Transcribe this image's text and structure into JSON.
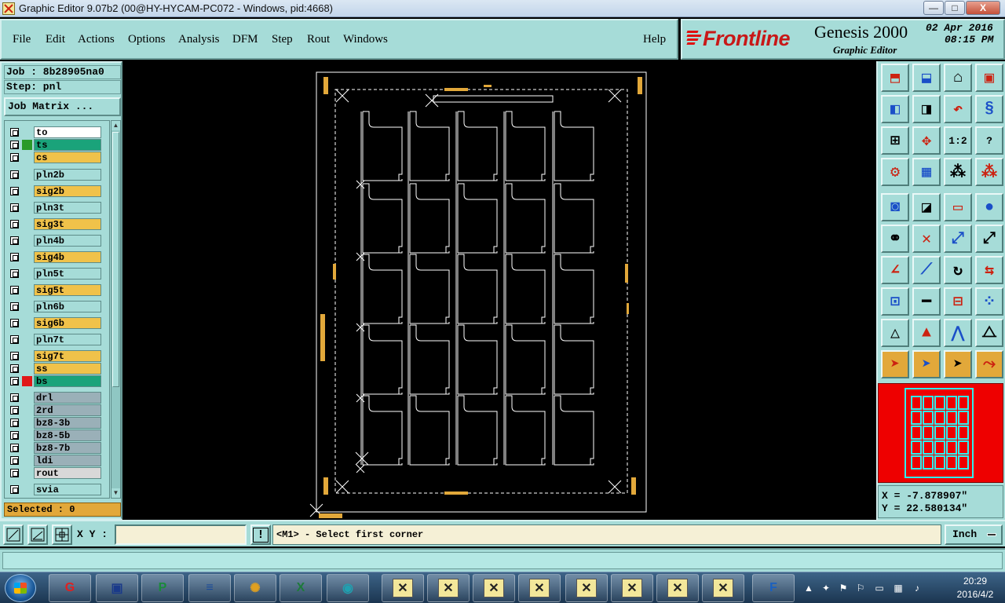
{
  "window": {
    "title": "Graphic Editor 9.07b2 (00@HY-HYCAM-PC072 - Windows, pid:4668)",
    "minimize_label": "—",
    "maximize_label": "□",
    "close_label": "X"
  },
  "menu": {
    "items": [
      {
        "id": "file",
        "label": "File"
      },
      {
        "id": "edit",
        "label": "Edit"
      },
      {
        "id": "actions",
        "label": "Actions"
      },
      {
        "id": "options",
        "label": "Options"
      },
      {
        "id": "analysis",
        "label": "Analysis"
      },
      {
        "id": "dfm",
        "label": "DFM"
      },
      {
        "id": "step",
        "label": "Step"
      },
      {
        "id": "rout",
        "label": "Rout"
      },
      {
        "id": "windows",
        "label": "Windows"
      },
      {
        "id": "help",
        "label": "Help"
      }
    ]
  },
  "brand": {
    "logo": "Frontline",
    "product": "Genesis 2000",
    "subtitle": "Graphic Editor",
    "date": "02 Apr 2016",
    "time": "08:15 PM"
  },
  "job": {
    "job_text": "Job : 8b28905na0",
    "step_text": "Step: pnl",
    "job_matrix_label": "Job Matrix ...",
    "selected_text": "Selected : 0"
  },
  "layers": [
    {
      "name": "to",
      "color": "#ffffff",
      "swatch": ""
    },
    {
      "name": "ts",
      "color": "#1aa37a",
      "swatch": "#2a9a2a"
    },
    {
      "name": "cs",
      "color": "#f0c24a",
      "swatch": ""
    },
    {
      "name": "pln2b",
      "color": "#a6dcd8",
      "swatch": ""
    },
    {
      "name": "sig2b",
      "color": "#f0c24a",
      "swatch": ""
    },
    {
      "name": "pln3t",
      "color": "#a6dcd8",
      "swatch": ""
    },
    {
      "name": "sig3t",
      "color": "#f0c24a",
      "swatch": ""
    },
    {
      "name": "pln4b",
      "color": "#a6dcd8",
      "swatch": ""
    },
    {
      "name": "sig4b",
      "color": "#f0c24a",
      "swatch": ""
    },
    {
      "name": "pln5t",
      "color": "#a6dcd8",
      "swatch": ""
    },
    {
      "name": "sig5t",
      "color": "#f0c24a",
      "swatch": ""
    },
    {
      "name": "pln6b",
      "color": "#a6dcd8",
      "swatch": ""
    },
    {
      "name": "sig6b",
      "color": "#f0c24a",
      "swatch": ""
    },
    {
      "name": "pln7t",
      "color": "#a6dcd8",
      "swatch": ""
    },
    {
      "name": "sig7t",
      "color": "#f0c24a",
      "swatch": ""
    },
    {
      "name": "ss",
      "color": "#f0c24a",
      "swatch": ""
    },
    {
      "name": "bs",
      "color": "#1aa37a",
      "swatch": "#e01818"
    },
    {
      "name": "drl",
      "color": "#9ab0b8",
      "swatch": ""
    },
    {
      "name": "2rd",
      "color": "#9ab0b8",
      "swatch": ""
    },
    {
      "name": "bz8-3b",
      "color": "#9ab0b8",
      "swatch": ""
    },
    {
      "name": "bz8-5b",
      "color": "#9ab0b8",
      "swatch": ""
    },
    {
      "name": "bz8-7b",
      "color": "#9ab0b8",
      "swatch": ""
    },
    {
      "name": "ldi",
      "color": "#9ab0b8",
      "swatch": ""
    },
    {
      "name": "rout",
      "color": "#d8d8d8",
      "swatch": ""
    },
    {
      "name": "svia",
      "color": "#a6dcd8",
      "swatch": ""
    }
  ],
  "tools": [
    {
      "icon": "zoom-home-icon"
    },
    {
      "icon": "zoom-in-icon"
    },
    {
      "icon": "home-view-icon"
    },
    {
      "icon": "fit-icon"
    },
    {
      "icon": "pan-left-icon"
    },
    {
      "icon": "pan-right-icon"
    },
    {
      "icon": "step-back-icon"
    },
    {
      "icon": "snap-icon"
    },
    {
      "icon": "zoom-extents-icon"
    },
    {
      "icon": "center-icon"
    },
    {
      "icon": "scale-icon",
      "text": "1:2"
    },
    {
      "icon": "help-icon",
      "text": "?"
    },
    {
      "icon": "filter-icon"
    },
    {
      "icon": "grid-icon"
    },
    {
      "icon": "layer-select-icon"
    },
    {
      "icon": "layer-display-icon"
    },
    {
      "icon": "pad-icon"
    },
    {
      "icon": "outline-icon"
    },
    {
      "icon": "ruler-icon"
    },
    {
      "icon": "round-pad-icon"
    },
    {
      "icon": "net-icon"
    },
    {
      "icon": "junction-icon"
    },
    {
      "icon": "pin-icon"
    },
    {
      "icon": "pin-alt-icon"
    },
    {
      "icon": "line-icon"
    },
    {
      "icon": "diagonal-line-icon"
    },
    {
      "icon": "arc-icon"
    },
    {
      "icon": "flip-icon"
    },
    {
      "icon": "add-pad-icon"
    },
    {
      "icon": "bar-icon"
    },
    {
      "icon": "measure-icon"
    },
    {
      "icon": "cluster-icon"
    },
    {
      "icon": "triangle-icon"
    },
    {
      "icon": "triangle-up-icon"
    },
    {
      "icon": "triangle-open-icon"
    },
    {
      "icon": "triangle-cut-icon"
    },
    {
      "icon": "pointer-icon"
    },
    {
      "icon": "select-pointer-icon"
    },
    {
      "icon": "circle-pointer-icon"
    },
    {
      "icon": "route-pointer-icon"
    }
  ],
  "coords": {
    "x_text": "X = -7.878907\"",
    "y_text": "Y = 22.580134\""
  },
  "command": {
    "xy_label": "X Y :",
    "xy_value": "",
    "warning_label": "!",
    "prompt": "<M1> - Select first corner",
    "unit": "Inch"
  },
  "taskbar": {
    "apps": [
      {
        "icon": "app-red-g-icon",
        "glyph": "G",
        "color": "#e02020"
      },
      {
        "icon": "save-disk-icon",
        "glyph": "▣",
        "color": "#1a3a8a"
      },
      {
        "icon": "app-green-p-icon",
        "glyph": "P",
        "color": "#1a8a3a"
      },
      {
        "icon": "notepad-icon",
        "glyph": "≡",
        "color": "#1a4a9a"
      },
      {
        "icon": "shell-icon",
        "glyph": "✺",
        "color": "#e0a020"
      },
      {
        "icon": "excel-icon",
        "glyph": "X",
        "color": "#1d7a3a"
      },
      {
        "icon": "eye-app-icon",
        "glyph": "◉",
        "color": "#20a0b0"
      },
      {
        "icon": "x-window-icon",
        "glyph": "✕",
        "color": "#222"
      },
      {
        "icon": "x-window-icon",
        "glyph": "✕",
        "color": "#222"
      },
      {
        "icon": "x-window-icon",
        "glyph": "✕",
        "color": "#222"
      },
      {
        "icon": "x-window-icon",
        "glyph": "✕",
        "color": "#222"
      },
      {
        "icon": "x-window-icon",
        "glyph": "✕",
        "color": "#222"
      },
      {
        "icon": "x-window-icon",
        "glyph": "✕",
        "color": "#222"
      },
      {
        "icon": "x-window-icon",
        "glyph": "✕",
        "color": "#222"
      },
      {
        "icon": "x-window-icon",
        "glyph": "✕",
        "color": "#222"
      },
      {
        "icon": "frontline-app-icon",
        "glyph": "F",
        "color": "#1a60c0"
      }
    ],
    "time": "20:29",
    "date": "2016/4/2"
  }
}
